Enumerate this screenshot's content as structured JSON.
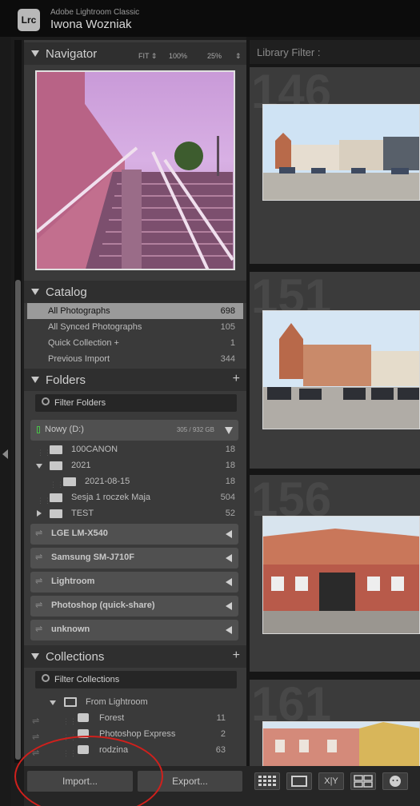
{
  "app": {
    "title": "Adobe Lightroom Classic",
    "logo": "Lrc",
    "user": "Iwona Wozniak"
  },
  "navigator": {
    "title": "Navigator",
    "fit": "FIT",
    "zoom1": "100%",
    "zoom2": "25%"
  },
  "catalog": {
    "title": "Catalog",
    "items": [
      {
        "label": "All Photographs",
        "count": "698"
      },
      {
        "label": "All Synced Photographs",
        "count": "105"
      },
      {
        "label": "Quick Collection  +",
        "count": "1"
      },
      {
        "label": "Previous Import",
        "count": "344"
      }
    ]
  },
  "folders": {
    "title": "Folders",
    "filter": "Filter Folders",
    "volume": {
      "label": "Nowy (D:)",
      "size": "305 / 932 GB"
    },
    "items": [
      {
        "label": "100CANON",
        "count": "18"
      },
      {
        "label": "2021",
        "count": "18"
      },
      {
        "label": "2021-08-15",
        "count": "18"
      },
      {
        "label": "Sesja 1 roczek Maja",
        "count": "504"
      },
      {
        "label": "TEST",
        "count": "52"
      }
    ],
    "devices": [
      "LGE LM-X540",
      "Samsung SM-J710F",
      "Lightroom",
      "Photoshop (quick-share)",
      "unknown"
    ]
  },
  "collections": {
    "title": "Collections",
    "filter": "Filter Collections",
    "set": "From Lightroom",
    "items": [
      {
        "label": "Forest",
        "count": "11"
      },
      {
        "label": "Photoshop Express",
        "count": "2"
      },
      {
        "label": "rodzina",
        "count": "63"
      }
    ]
  },
  "bottom": {
    "import": "Import...",
    "export": "Export..."
  },
  "library": {
    "filter": "Library Filter :",
    "cells": [
      "146",
      "151",
      "156",
      "161"
    ]
  },
  "toolbar": {
    "icons": [
      "grid-view-icon",
      "loupe-view-icon",
      "compare-view-icon",
      "survey-view-icon",
      "people-view-icon"
    ],
    "compare_label": "X|Y"
  },
  "colors": {
    "panel": "#3a3a3a",
    "header": "#2f2f2f",
    "selected": "#9a9a9a",
    "annotation_circle": "#d0201c"
  }
}
